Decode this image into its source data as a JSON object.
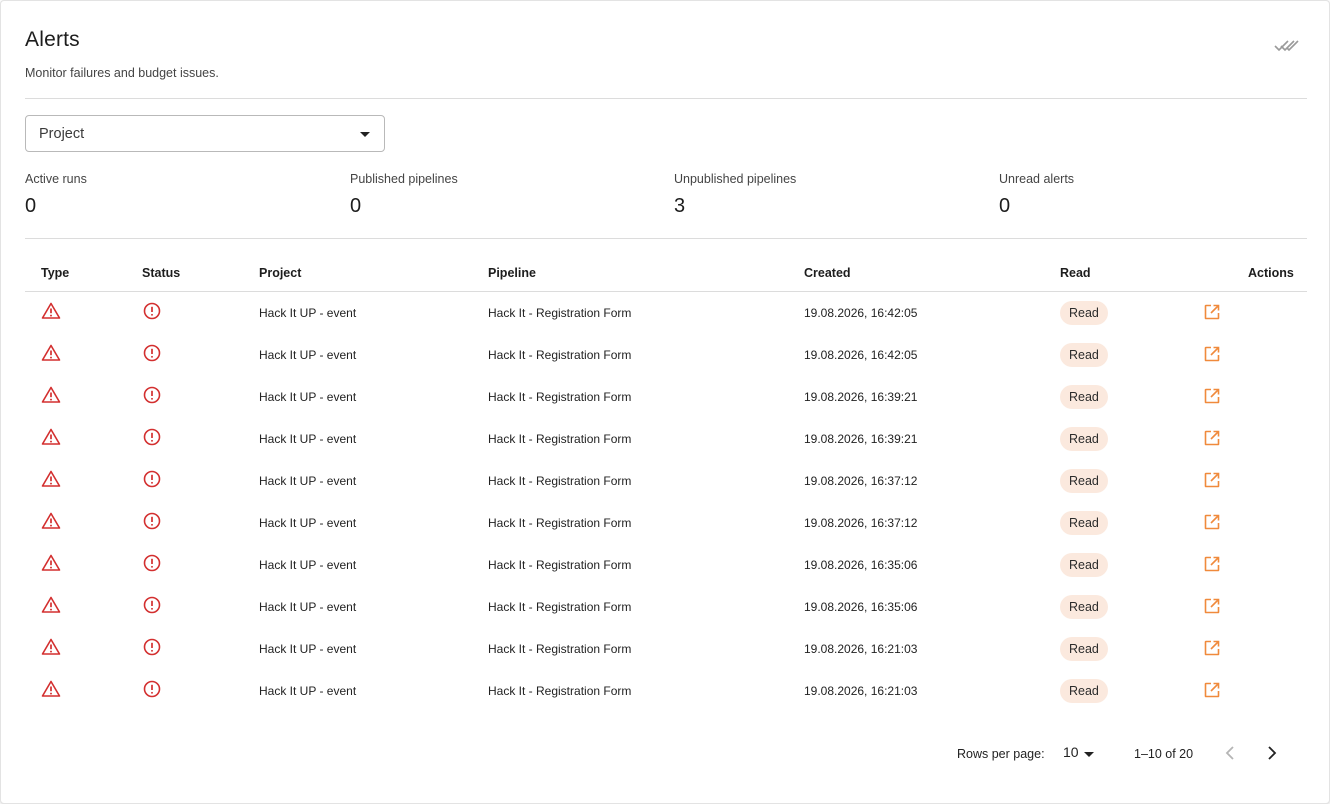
{
  "header": {
    "title": "Alerts",
    "subtitle": "Monitor failures and budget issues.",
    "mark_all_icon": "double-check-icon"
  },
  "filter": {
    "project_label": "Project"
  },
  "stats": [
    {
      "label": "Active runs",
      "value": "0"
    },
    {
      "label": "Published pipelines",
      "value": "0"
    },
    {
      "label": "Unpublished pipelines",
      "value": "3"
    },
    {
      "label": "Unread alerts",
      "value": "0"
    }
  ],
  "table": {
    "columns": [
      "Type",
      "Status",
      "Project",
      "Pipeline",
      "Created",
      "Read",
      "Actions"
    ],
    "rows": [
      {
        "project": "Hack It UP - event",
        "pipeline": "Hack It - Registration Form",
        "created": "19.08.2026, 16:42:05",
        "read": "Read"
      },
      {
        "project": "Hack It UP - event",
        "pipeline": "Hack It - Registration Form",
        "created": "19.08.2026, 16:42:05",
        "read": "Read"
      },
      {
        "project": "Hack It UP - event",
        "pipeline": "Hack It - Registration Form",
        "created": "19.08.2026, 16:39:21",
        "read": "Read"
      },
      {
        "project": "Hack It UP - event",
        "pipeline": "Hack It - Registration Form",
        "created": "19.08.2026, 16:39:21",
        "read": "Read"
      },
      {
        "project": "Hack It UP - event",
        "pipeline": "Hack It - Registration Form",
        "created": "19.08.2026, 16:37:12",
        "read": "Read"
      },
      {
        "project": "Hack It UP - event",
        "pipeline": "Hack It - Registration Form",
        "created": "19.08.2026, 16:37:12",
        "read": "Read"
      },
      {
        "project": "Hack It UP - event",
        "pipeline": "Hack It - Registration Form",
        "created": "19.08.2026, 16:35:06",
        "read": "Read"
      },
      {
        "project": "Hack It UP - event",
        "pipeline": "Hack It - Registration Form",
        "created": "19.08.2026, 16:35:06",
        "read": "Read"
      },
      {
        "project": "Hack It UP - event",
        "pipeline": "Hack It - Registration Form",
        "created": "19.08.2026, 16:21:03",
        "read": "Read"
      },
      {
        "project": "Hack It UP - event",
        "pipeline": "Hack It - Registration Form",
        "created": "19.08.2026, 16:21:03",
        "read": "Read"
      }
    ],
    "type_icon": "warning-triangle-icon",
    "status_icon": "error-circle-icon",
    "action_icon": "open-in-new-icon"
  },
  "pagination": {
    "rows_per_page_label": "Rows per page:",
    "rows_per_page": "10",
    "range": "1–10 of 20"
  },
  "colors": {
    "error": "#d32f2f",
    "accent": "#f08a3c",
    "badge_bg": "#fbe9de",
    "divider": "#dcdcdc"
  }
}
